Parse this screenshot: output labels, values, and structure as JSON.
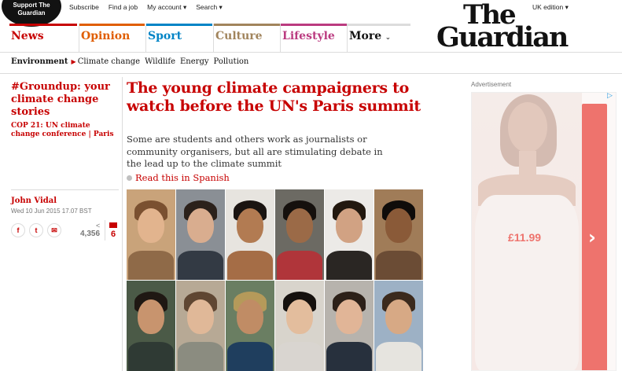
{
  "topbar": {
    "support_line1": "Support The",
    "support_line2": "Guardian",
    "links": [
      "Subscribe",
      "Find a job",
      "My account ▾",
      "Search ▾"
    ],
    "edition": "UK edition ▾"
  },
  "logo": {
    "line1": "The",
    "line2": "Guardian"
  },
  "nav": {
    "items": [
      {
        "label": "News",
        "color": "#c70000"
      },
      {
        "label": "Opinion",
        "color": "#e05e00"
      },
      {
        "label": "Sport",
        "color": "#0084c6"
      },
      {
        "label": "Culture",
        "color": "#a1845c"
      },
      {
        "label": "Lifestyle",
        "color": "#bb3b80"
      },
      {
        "label": "More",
        "color": "#121212"
      }
    ],
    "more_chevron": "chevron-down-icon"
  },
  "subnav": {
    "section": "Environment",
    "active_arrow": "▶",
    "subsections": [
      "Climate change",
      "Wildlife",
      "Energy",
      "Pollution"
    ]
  },
  "article": {
    "series_title": "#Groundup: your climate change stories",
    "series_sub": "COP 21: UN climate change conference | Paris",
    "author": "John Vidal",
    "date": "Wed 10 Jun 2015 17.07 BST",
    "share_icons": [
      "facebook-icon",
      "twitter-icon",
      "email-icon"
    ],
    "share_glyphs": [
      "f",
      "t",
      "✉"
    ],
    "share_count": "4,356",
    "share_count_icon": "<",
    "comment_count": "6",
    "headline": "The young climate campaigners to watch before the UN's Paris summit",
    "standfirst": "Some are students and others work as journalists or community organisers, but all are stimulating debate in the lead up to the climate summit",
    "read_link": "Read this in Spanish"
  },
  "ad": {
    "label": "Advertisement",
    "price": "£11.99",
    "arrow": "›",
    "adchoices": "▷"
  },
  "colors": {
    "brand_red": "#c70000",
    "ad_red": "#e8453c"
  }
}
